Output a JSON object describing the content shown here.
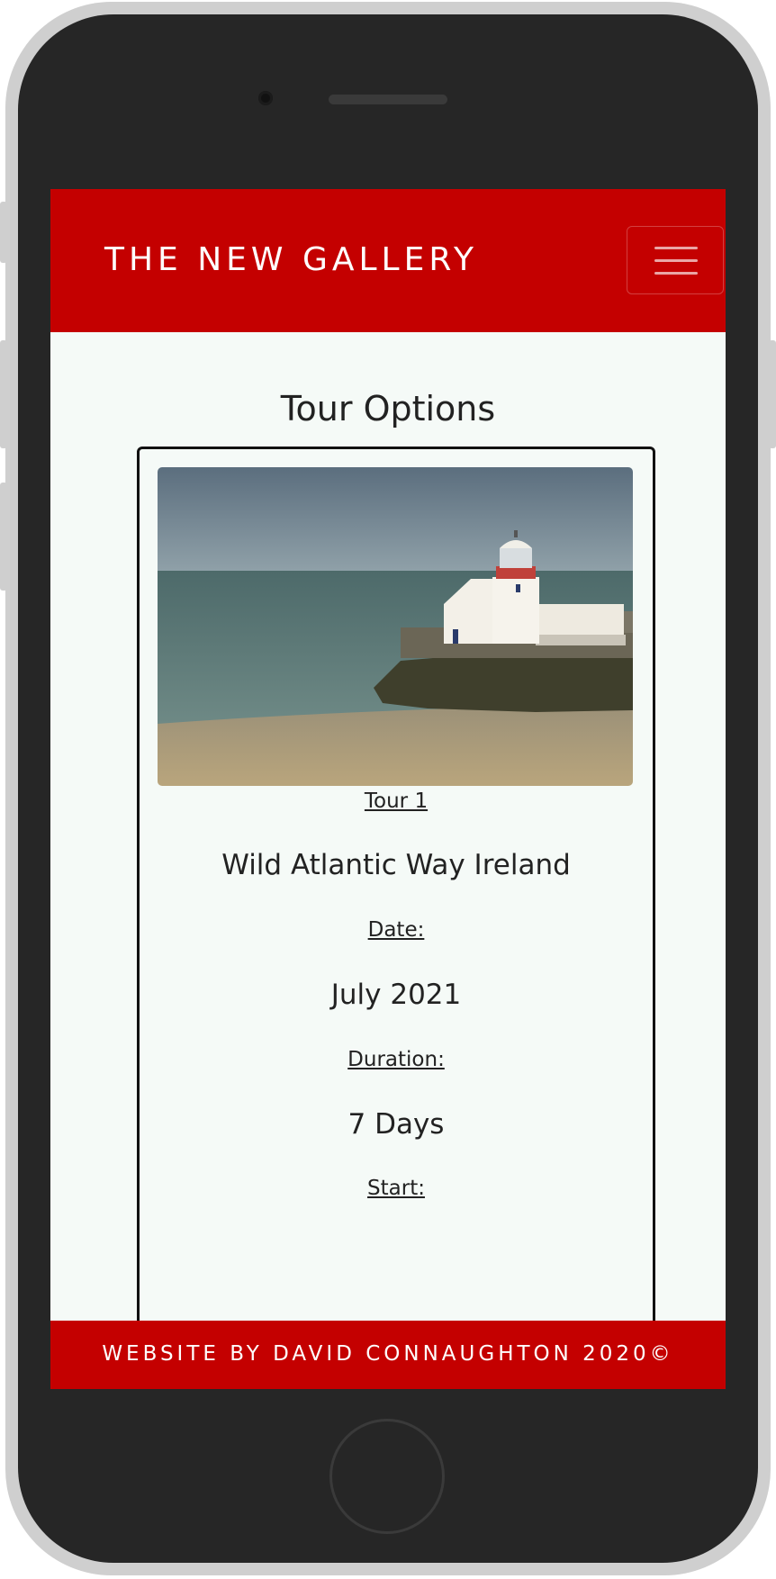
{
  "navbar": {
    "brand": "THE NEW GALLERY",
    "toggle_icon": "hamburger-menu-icon"
  },
  "page": {
    "title": "Tour Options"
  },
  "tour": {
    "image_alt": "lighthouse-photo",
    "number_label": "Tour 1",
    "name": "Wild Atlantic Way Ireland",
    "date_label": "Date:",
    "date": "July 2021",
    "duration_label": "Duration:",
    "duration": "7 Days",
    "start_label": "Start:"
  },
  "footer": {
    "text": "WEBSITE BY DAVID CONNAUGHTON 2020©"
  },
  "colors": {
    "brand_red": "#c40000",
    "page_bg": "#f5faf7",
    "phone_body": "#262626"
  }
}
